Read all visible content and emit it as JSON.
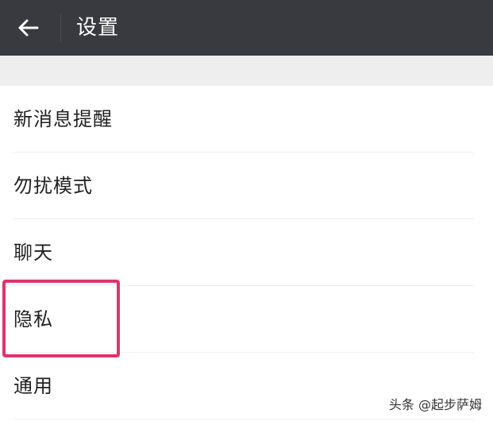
{
  "header": {
    "title": "设置",
    "back_icon": "arrow-left-icon",
    "background_color": "#393a3f",
    "title_color": "#ffffff"
  },
  "settings": {
    "items": [
      {
        "label": "新消息提醒"
      },
      {
        "label": "勿扰模式"
      },
      {
        "label": "聊天"
      },
      {
        "label": "隐私"
      },
      {
        "label": "通用"
      }
    ]
  },
  "annotation": {
    "highlight_color": "#e0336e"
  },
  "watermark": {
    "text": "头条 @起步萨姆"
  }
}
